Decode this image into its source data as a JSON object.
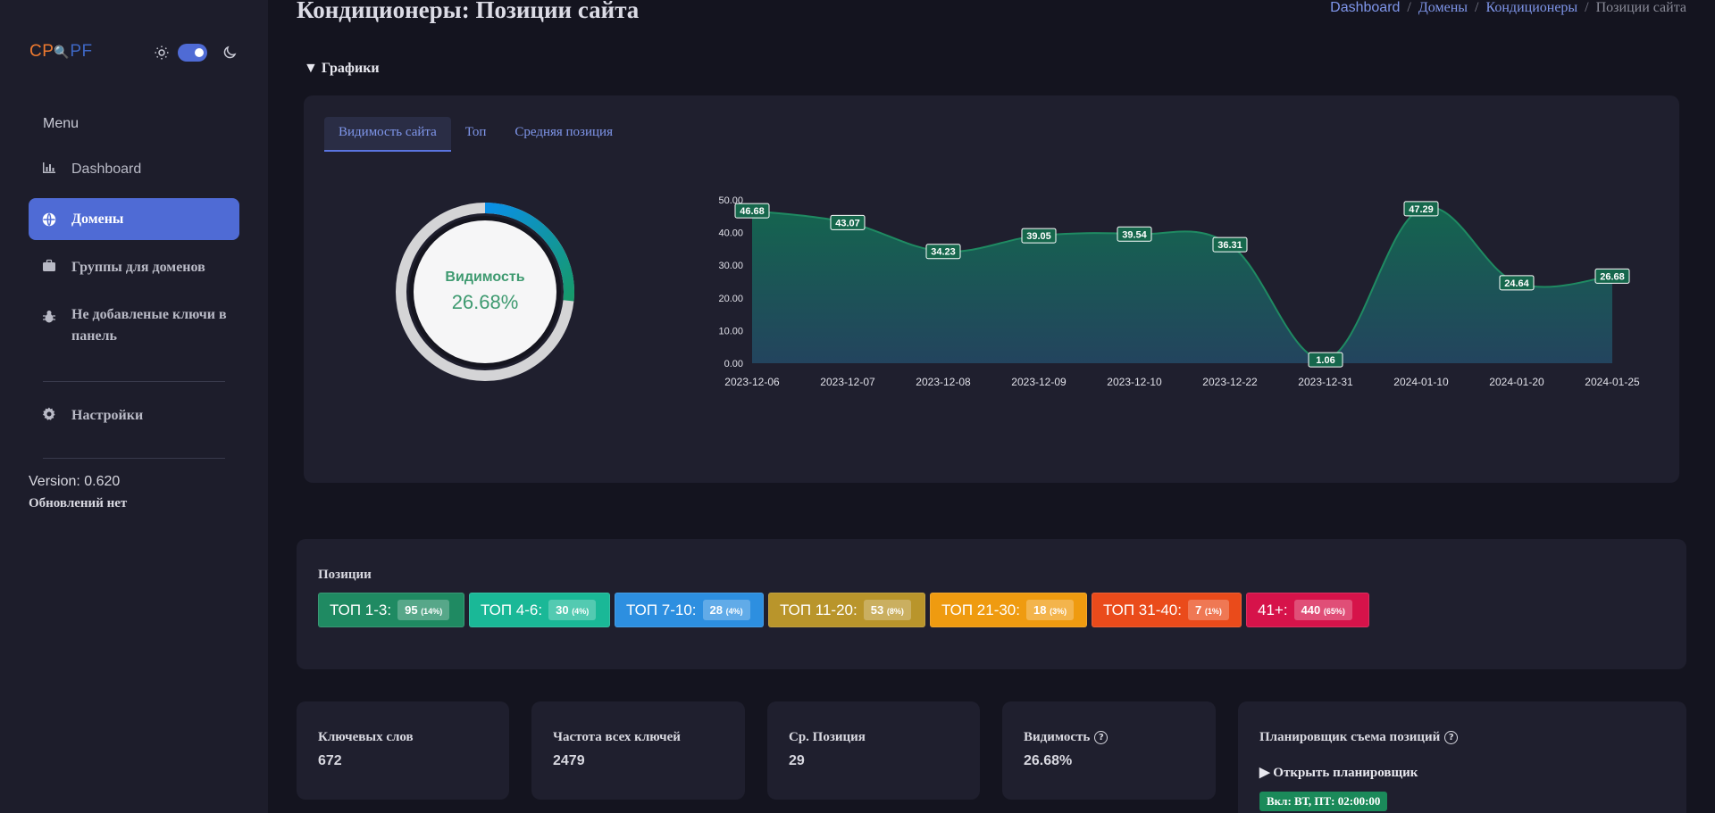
{
  "logo": {
    "part1": "CP",
    "part2": "PF"
  },
  "sidebar": {
    "menu_heading": "Menu",
    "items": [
      {
        "label": "Dashboard"
      },
      {
        "label": "Домены"
      },
      {
        "label": "Группы для доменов"
      },
      {
        "label": "Не добавленые ключи в панель"
      },
      {
        "label": "Настройки"
      }
    ],
    "version": "Version: 0.620",
    "updates": "Обновлений нет"
  },
  "header": {
    "title": "Кондиционеры: Позиции сайта",
    "breadcrumb": [
      "Dashboard",
      "Домены",
      "Кондиционеры",
      "Позиции сайта"
    ],
    "sep": "/"
  },
  "charts_section": {
    "toggle_label": "▼ Графики",
    "tabs": [
      "Видимость сайта",
      "Топ",
      "Средняя позиция"
    ],
    "donut": {
      "label": "Видимость",
      "value": "26.68%"
    }
  },
  "chart_data": {
    "type": "area",
    "x": [
      "2023-12-06",
      "2023-12-07",
      "2023-12-08",
      "2023-12-09",
      "2023-12-10",
      "2023-12-22",
      "2023-12-31",
      "2024-01-10",
      "2024-01-20",
      "2024-01-25"
    ],
    "values": [
      46.68,
      43.07,
      34.23,
      39.05,
      39.54,
      36.31,
      1.06,
      47.29,
      24.64,
      26.68
    ],
    "ylim": [
      0,
      50
    ],
    "yticks": [
      "0.00",
      "10.00",
      "20.00",
      "30.00",
      "40.00",
      "50.00"
    ],
    "donut_fraction": 0.2668,
    "colors": {
      "line": "#1f8a62",
      "fill_top": "#14654f",
      "fill_bottom": "#23445e",
      "label_bg": "#16674c"
    }
  },
  "positions": {
    "title": "Позиции",
    "badges": [
      {
        "label": "ТОП 1-3:",
        "count": "95",
        "pct": "(14%)",
        "color": "#1f8a62"
      },
      {
        "label": "ТОП 4-6:",
        "count": "30",
        "pct": "(4%)",
        "color": "#1ab897"
      },
      {
        "label": "ТОП 7-10:",
        "count": "28",
        "pct": "(4%)",
        "color": "#2d8fe0"
      },
      {
        "label": "ТОП 11-20:",
        "count": "53",
        "pct": "(8%)",
        "color": "#b9952b"
      },
      {
        "label": "ТОП 21-30:",
        "count": "18",
        "pct": "(3%)",
        "color": "#ef9b10"
      },
      {
        "label": "ТОП 31-40:",
        "count": "7",
        "pct": "(1%)",
        "color": "#ea4b1b"
      },
      {
        "label": "41+:",
        "count": "440",
        "pct": "(65%)",
        "color": "#d6134a"
      }
    ]
  },
  "stats": [
    {
      "title": "Ключевых слов",
      "value": "672"
    },
    {
      "title": "Частота всех ключей",
      "value": "2479"
    },
    {
      "title": "Ср. Позиция",
      "value": "29"
    },
    {
      "title": "Видимость",
      "value": "26.68%"
    }
  ],
  "scheduler": {
    "title": "Планировщик съема позиций",
    "open": "▶ Открыть планировщик",
    "schedule": "Вкл: ВТ, ПТ: 02:00:00"
  }
}
